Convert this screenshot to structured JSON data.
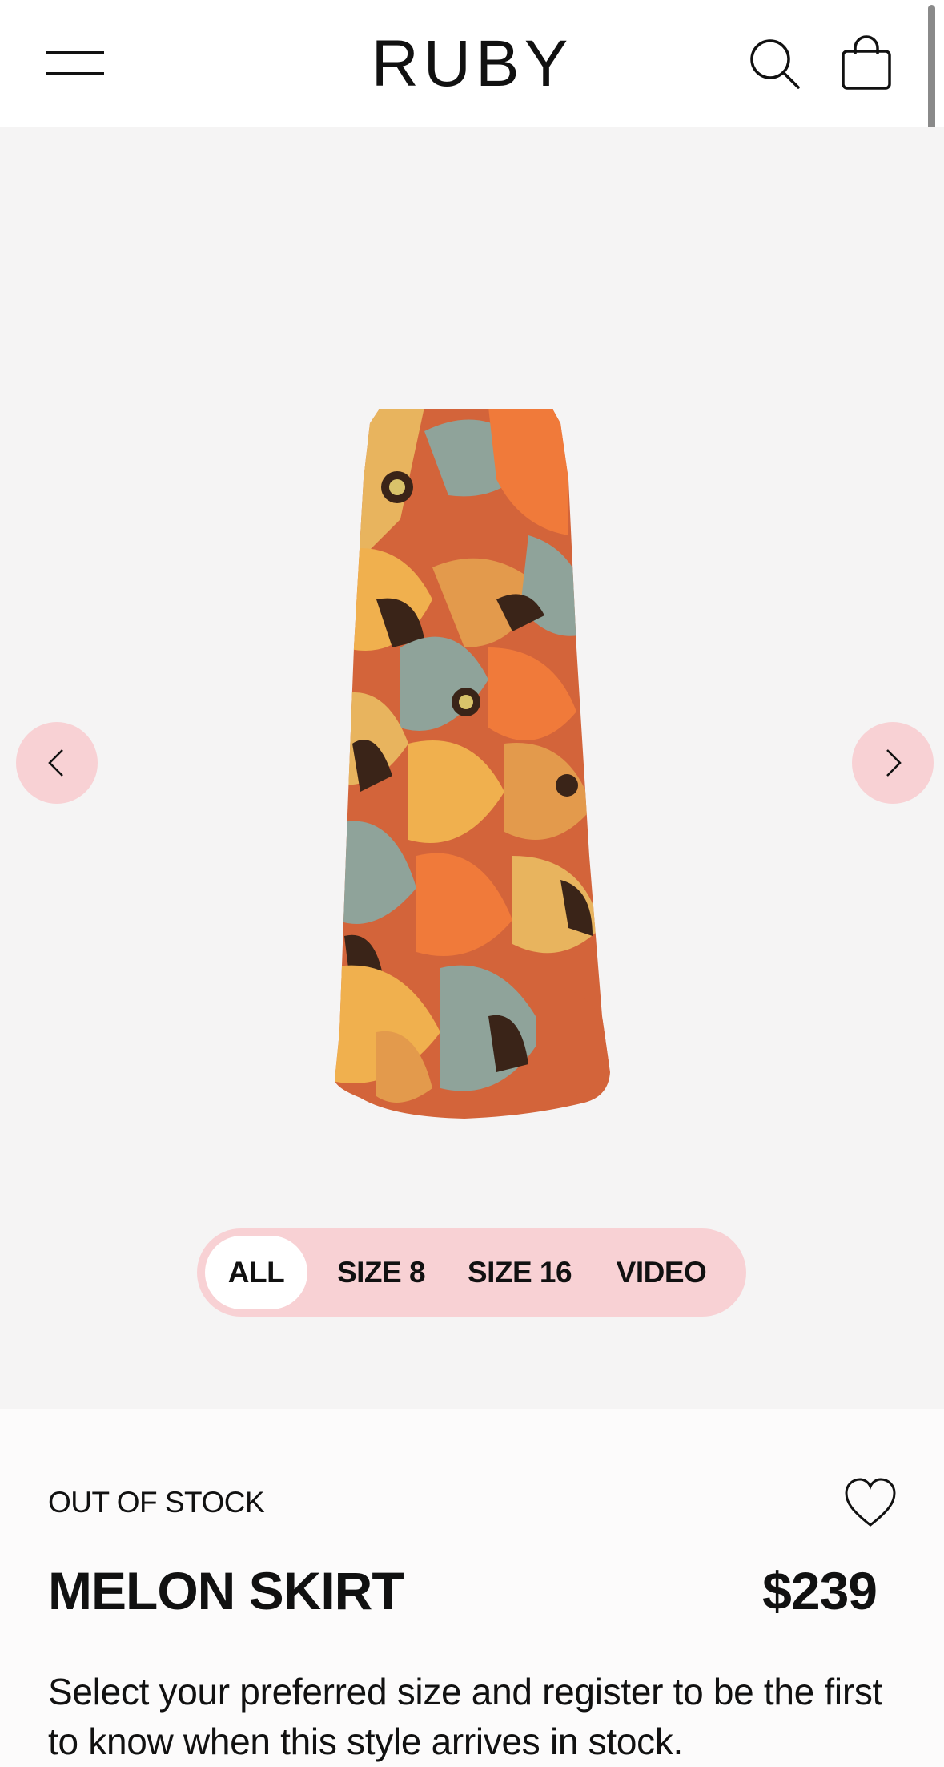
{
  "header": {
    "brand": "RUBY",
    "menu_icon": "hamburger-menu-icon",
    "search_icon": "search-icon",
    "cart_icon": "shopping-bag-icon"
  },
  "gallery": {
    "prev_icon": "chevron-left-icon",
    "next_icon": "chevron-right-icon",
    "image_alt": "Melon skirt product photo",
    "filters": [
      {
        "label": "ALL",
        "active": true
      },
      {
        "label": "SIZE 8",
        "active": false
      },
      {
        "label": "SIZE 16",
        "active": false
      },
      {
        "label": "VIDEO",
        "active": false
      }
    ]
  },
  "product": {
    "stock_status": "OUT OF STOCK",
    "name": "MELON SKIRT",
    "price": "$239",
    "description": "Select your preferred size and register to be the first to know when this style arrives in stock.",
    "wishlist_icon": "heart-icon"
  },
  "colors": {
    "accent_pink": "#f8d1d4",
    "gallery_bg": "#f5f4f4"
  }
}
